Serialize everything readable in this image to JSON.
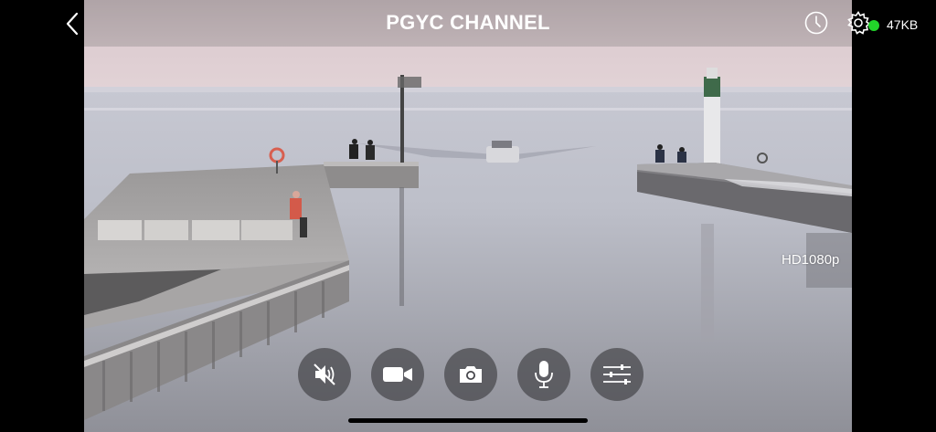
{
  "header": {
    "title": "PGYC CHANNEL",
    "bitrate": "47KB",
    "back_icon": "chevron-left-icon",
    "history_icon": "clock-icon",
    "settings_icon": "gear-icon",
    "status_color": "#22d32a"
  },
  "stream": {
    "resolution": "HD1080p"
  },
  "controls": [
    {
      "name": "mute",
      "icon": "speaker-muted-icon"
    },
    {
      "name": "record",
      "icon": "video-camera-icon"
    },
    {
      "name": "snapshot",
      "icon": "camera-icon"
    },
    {
      "name": "microphone",
      "icon": "microphone-icon"
    },
    {
      "name": "adjust",
      "icon": "sliders-icon"
    }
  ]
}
